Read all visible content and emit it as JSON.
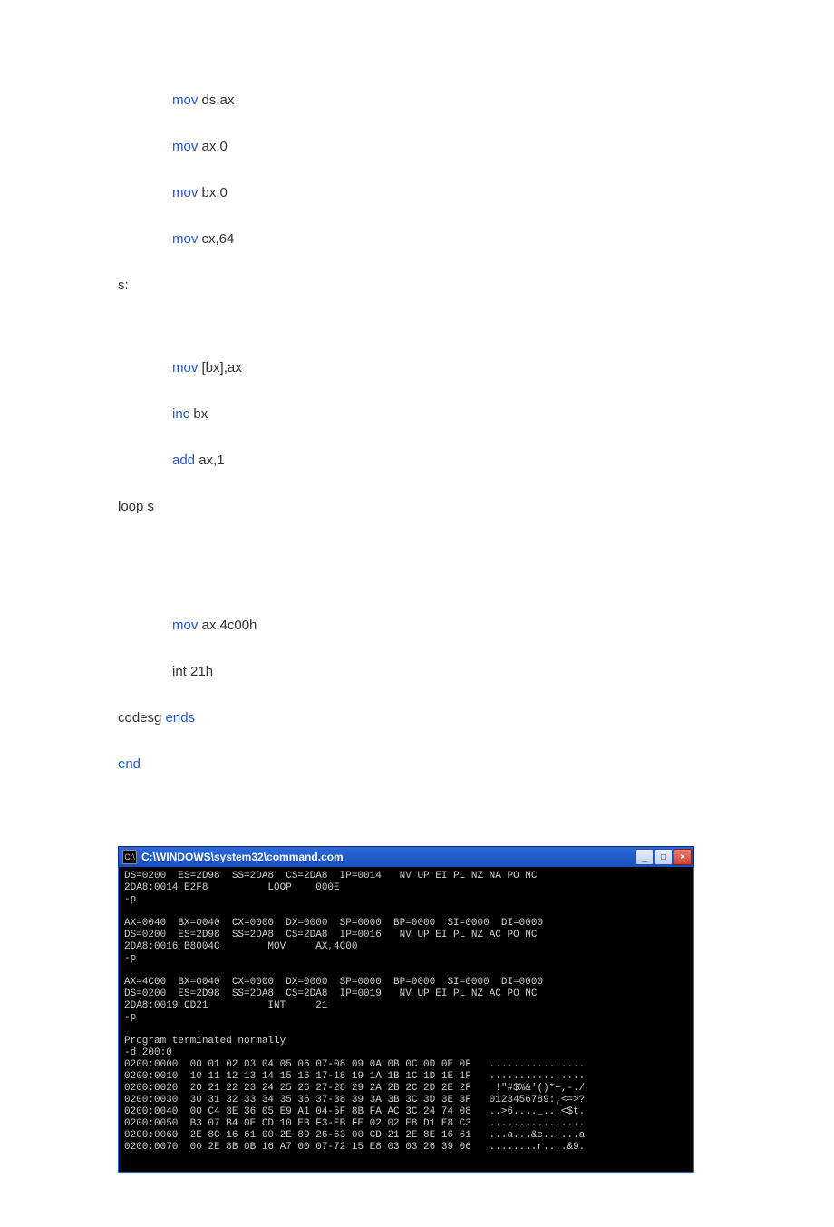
{
  "code": {
    "l1_kw": "mov",
    "l1_rest": " ds,ax",
    "l2_kw": "mov",
    "l2_rest": " ax,0",
    "l3_kw": "mov",
    "l3_rest": " bx,0",
    "l4_kw": "mov",
    "l4_rest": " cx,64",
    "label_s": "s:",
    "l5_kw": "mov",
    "l5_rest": " [bx],ax",
    "l6_kw": "inc",
    "l6_rest": " bx",
    "l7_kw": "add",
    "l7_rest": " ax,1",
    "loop": "loop s",
    "l8_kw": "mov",
    "l8_rest": " ax,4c00h",
    "l9": "int 21h",
    "l10_pre": "codesg ",
    "l10_kw": "ends",
    "l11_kw": "end"
  },
  "console": {
    "icon_text": "C:\\",
    "title": "C:\\WINDOWS\\system32\\command.com",
    "btn_min": "_",
    "btn_max": "□",
    "btn_close": "×",
    "lines": "DS=0200  ES=2D98  SS=2DA8  CS=2DA8  IP=0014   NV UP EI PL NZ NA PO NC\n2DA8:0014 E2F8          LOOP    000E\n-p\n\nAX=0040  BX=0040  CX=0000  DX=0000  SP=0000  BP=0000  SI=0000  DI=0000\nDS=0200  ES=2D98  SS=2DA8  CS=2DA8  IP=0016   NV UP EI PL NZ AC PO NC\n2DA8:0016 B8004C        MOV     AX,4C00\n-p\n\nAX=4C00  BX=0040  CX=0000  DX=0000  SP=0000  BP=0000  SI=0000  DI=0000\nDS=0200  ES=2D98  SS=2DA8  CS=2DA8  IP=0019   NV UP EI PL NZ AC PO NC\n2DA8:0019 CD21          INT     21\n-p\n\nProgram terminated normally\n-d 200:0\n0200:0000  00 01 02 03 04 05 06 07-08 09 0A 0B 0C 0D 0E 0F   ................\n0200:0010  10 11 12 13 14 15 16 17-18 19 1A 1B 1C 1D 1E 1F   ................\n0200:0020  20 21 22 23 24 25 26 27-28 29 2A 2B 2C 2D 2E 2F    !\"#$%&'()*+,-./\n0200:0030  30 31 32 33 34 35 36 37-38 39 3A 3B 3C 3D 3E 3F   0123456789:;<=>?\n0200:0040  00 C4 3E 36 05 E9 A1 04-5F 8B FA AC 3C 24 74 08   ..>6...._...<$t.\n0200:0050  B3 07 B4 0E CD 10 EB F3-EB FE 02 02 E8 D1 E8 C3   ................\n0200:0060  2E 8C 16 61 00 2E 89 26-63 00 CD 21 2E 8E 16 61   ...a...&c..!...a\n0200:0070  00 2E 8B 0B 16 A7 00 07-72 15 E8 03 03 26 39 06   ........r....&9."
  }
}
